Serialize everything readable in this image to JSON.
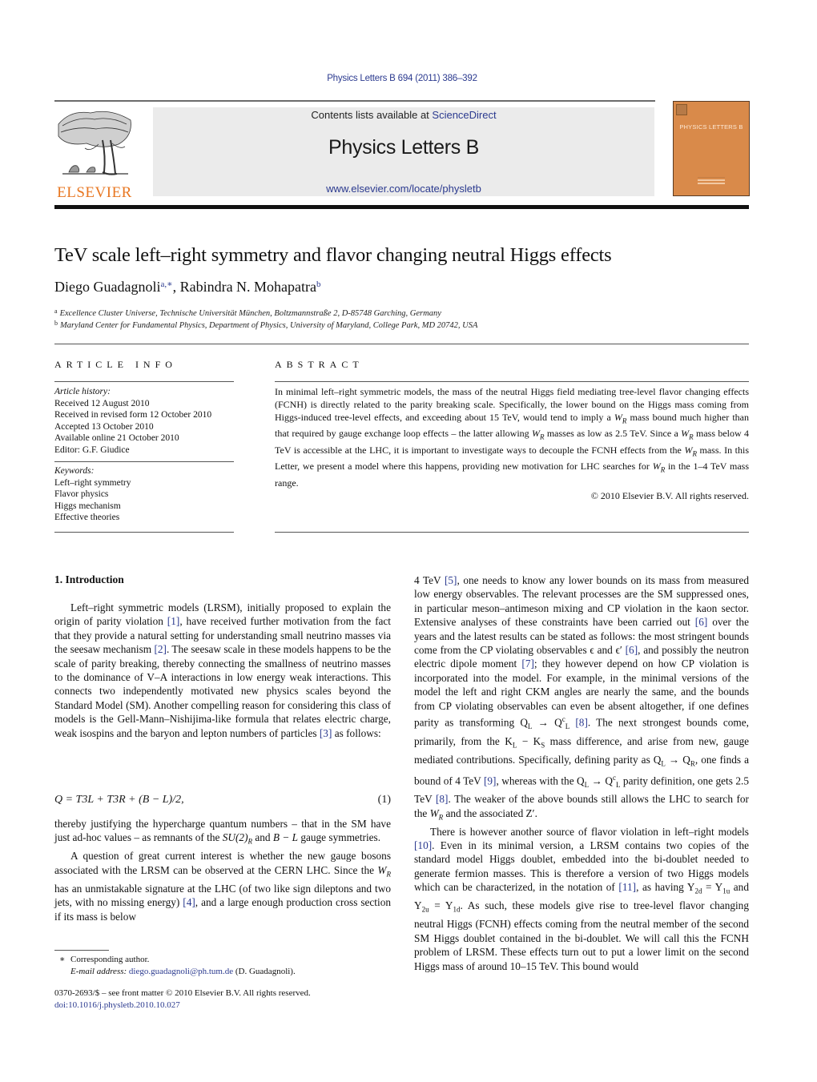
{
  "header": {
    "journal_ref": "Physics Letters B 694 (2011) 386–392",
    "contents_prefix": "Contents lists available at ",
    "contents_link": "ScienceDirect",
    "journal_title": "Physics Letters B",
    "journal_url": "www.elsevier.com/locate/physletb",
    "publisher_wordmark": "ELSEVIER",
    "cover_title": "PHYSICS LETTERS B",
    "colors": {
      "link": "#2b3a8f",
      "elsevier_orange": "#e87722",
      "cover": "#d98a4a",
      "banner_bg": "#ebebeb"
    }
  },
  "article": {
    "title": "TeV scale left–right symmetry and flavor changing neutral Higgs effects",
    "authors": [
      {
        "name": "Diego Guadagnoli",
        "marks": "a,∗"
      },
      {
        "name": "Rabindra N. Mohapatra",
        "marks": "b"
      }
    ],
    "author_separator": ", ",
    "affiliations": [
      {
        "mark": "a",
        "text": "Excellence Cluster Universe, Technische Universität München, Boltzmannstraße 2, D-85748 Garching, Germany"
      },
      {
        "mark": "b",
        "text": "Maryland Center for Fundamental Physics, Department of Physics, University of Maryland, College Park, MD 20742, USA"
      }
    ]
  },
  "article_info": {
    "heading": "ARTICLE INFO",
    "history_label": "Article history:",
    "history": [
      "Received 12 August 2010",
      "Received in revised form 12 October 2010",
      "Accepted 13 October 2010",
      "Available online 21 October 2010",
      "Editor: G.F. Giudice"
    ],
    "keywords_label": "Keywords:",
    "keywords": [
      "Left–right symmetry",
      "Flavor physics",
      "Higgs mechanism",
      "Effective theories"
    ]
  },
  "abstract": {
    "heading": "ABSTRACT",
    "p1": "In minimal left–right symmetric models, the mass of the neutral Higgs field mediating tree-level flavor changing effects (FCNH) is directly related to the parity breaking scale. Specifically, the lower bound on the Higgs mass coming from Higgs-induced tree-level effects, and exceeding about 15 TeV, would tend to imply a ",
    "p2": " mass bound much higher than that required by gauge exchange loop effects – the latter allowing ",
    "p3": " masses as low as 2.5 TeV. Since a ",
    "p4": " mass below 4 TeV is accessible at the LHC, it is important to investigate ways to decouple the FCNH effects from the ",
    "p5": " mass. In this Letter, we present a model where this happens, providing new motivation for LHC searches for ",
    "p6": " in the 1–4 TeV mass range.",
    "wr_symbol": "W",
    "wr_sub": "R",
    "copyright": "© 2010 Elsevier B.V. All rights reserved."
  },
  "intro": {
    "heading": "1.  Introduction",
    "left": {
      "a1": "Left–right symmetric models (LRSM), initially proposed to explain the origin of parity violation ",
      "r1": "[1]",
      "a2": ", have received further motivation from the fact that they provide a natural setting for understanding small neutrino masses via the seesaw mechanism ",
      "r2": "[2]",
      "a3": ". The seesaw scale in these models happens to be the scale of parity breaking, thereby connecting the smallness of neutrino masses to the dominance of V–A interactions in low energy weak interactions. This connects two independently motivated new physics scales beyond the Standard Model (SM). Another compelling reason for considering this class of models is the Gell-Mann–Nishijima-like formula that relates electric charge, weak isospins and the baryon and lepton numbers of particles ",
      "r3": "[3]",
      "a4": " as follows:",
      "equation": "Q = T3L + T3R + (B − L)/2,",
      "equation_number": "(1)",
      "b1": "thereby justifying the hypercharge quantum numbers – that in the SM have just ad-hoc values – as remnants of the ",
      "b_su2": "SU(2)",
      "b2": " and ",
      "b_bl": "B − L",
      "b3": " gauge symmetries.",
      "c1": "A question of great current interest is whether the new gauge bosons associated with the LRSM can be observed at the CERN LHC. Since the ",
      "c2": " has an unmistakable signature at the LHC (of two like sign dileptons and two jets, with no missing energy) ",
      "r4": "[4]",
      "c3": ", and a large enough production cross section if its mass is below"
    },
    "right": {
      "d1": "4 TeV ",
      "r5": "[5]",
      "d2": ", one needs to know any lower bounds on its mass from measured low energy observables. The relevant processes are the SM suppressed ones, in particular meson–antimeson mixing and CP violation in the kaon sector. Extensive analyses of these constraints have been carried out ",
      "r6": "[6]",
      "d3": " over the years and the latest results can be stated as follows: the most stringent bounds come from the CP violating observables ϵ and ϵ′ ",
      "r6b": "[6]",
      "d4": ", and possibly the neutron electric dipole moment ",
      "r7": "[7]",
      "d5": "; they however depend on how CP violation is incorporated into the model. For example, in the minimal versions of the model the left and right CKM angles are nearly the same, and the bounds from CP violating observables can even be absent altogether, if one defines parity as transforming Q",
      "d5b": " → Q",
      "r8": "[8]",
      "d6": ". The next strongest bounds come, primarily, from the K",
      "d6b": " − K",
      "d7": " mass difference, and arise from new, gauge mediated contributions. Specifically, defining parity as Q",
      "d7b": " → Q",
      "d8": ", one finds a bound of 4 TeV ",
      "r9": "[9]",
      "d9": ", whereas with the Q",
      "d9b": " → Q",
      "d10": " parity definition, one gets 2.5 TeV ",
      "r8b": "[8]",
      "d11": ". The weaker of the above bounds still allows the LHC to search for the ",
      "d12": " and the associated Z′.",
      "e1": "There is however another source of flavor violation in left–right models ",
      "r10": "[10]",
      "e2": ". Even in its minimal version, a LRSM contains two copies of the standard model Higgs doublet, embedded into the bi-doublet needed to generate fermion masses. This is therefore a version of two Higgs models which can be characterized, in the notation of ",
      "r11": "[11]",
      "e3": ", as having Y",
      "e3b": " = Y",
      "e3c": " and Y",
      "e3d": " = Y",
      "e4": ". As such, these models give rise to tree-level flavor changing neutral Higgs (FCNH) effects coming from the neutral member of the second SM Higgs doublet contained in the bi-doublet. We will call this the FCNH problem of LRSM. These effects turn out to put a lower limit on the second Higgs mass of around 10–15 TeV. This bound would"
    }
  },
  "footnote": {
    "star": "∗",
    "corresponding": "Corresponding author.",
    "email_label": "E-mail address:",
    "email": "diego.guadagnoli@ph.tum.de",
    "email_suffix": " (D. Guadagnoli)."
  },
  "front_matter": {
    "issn_line": "0370-2693/$ – see front matter  © 2010 Elsevier B.V. All rights reserved.",
    "doi": "doi:10.1016/j.physletb.2010.10.027"
  }
}
